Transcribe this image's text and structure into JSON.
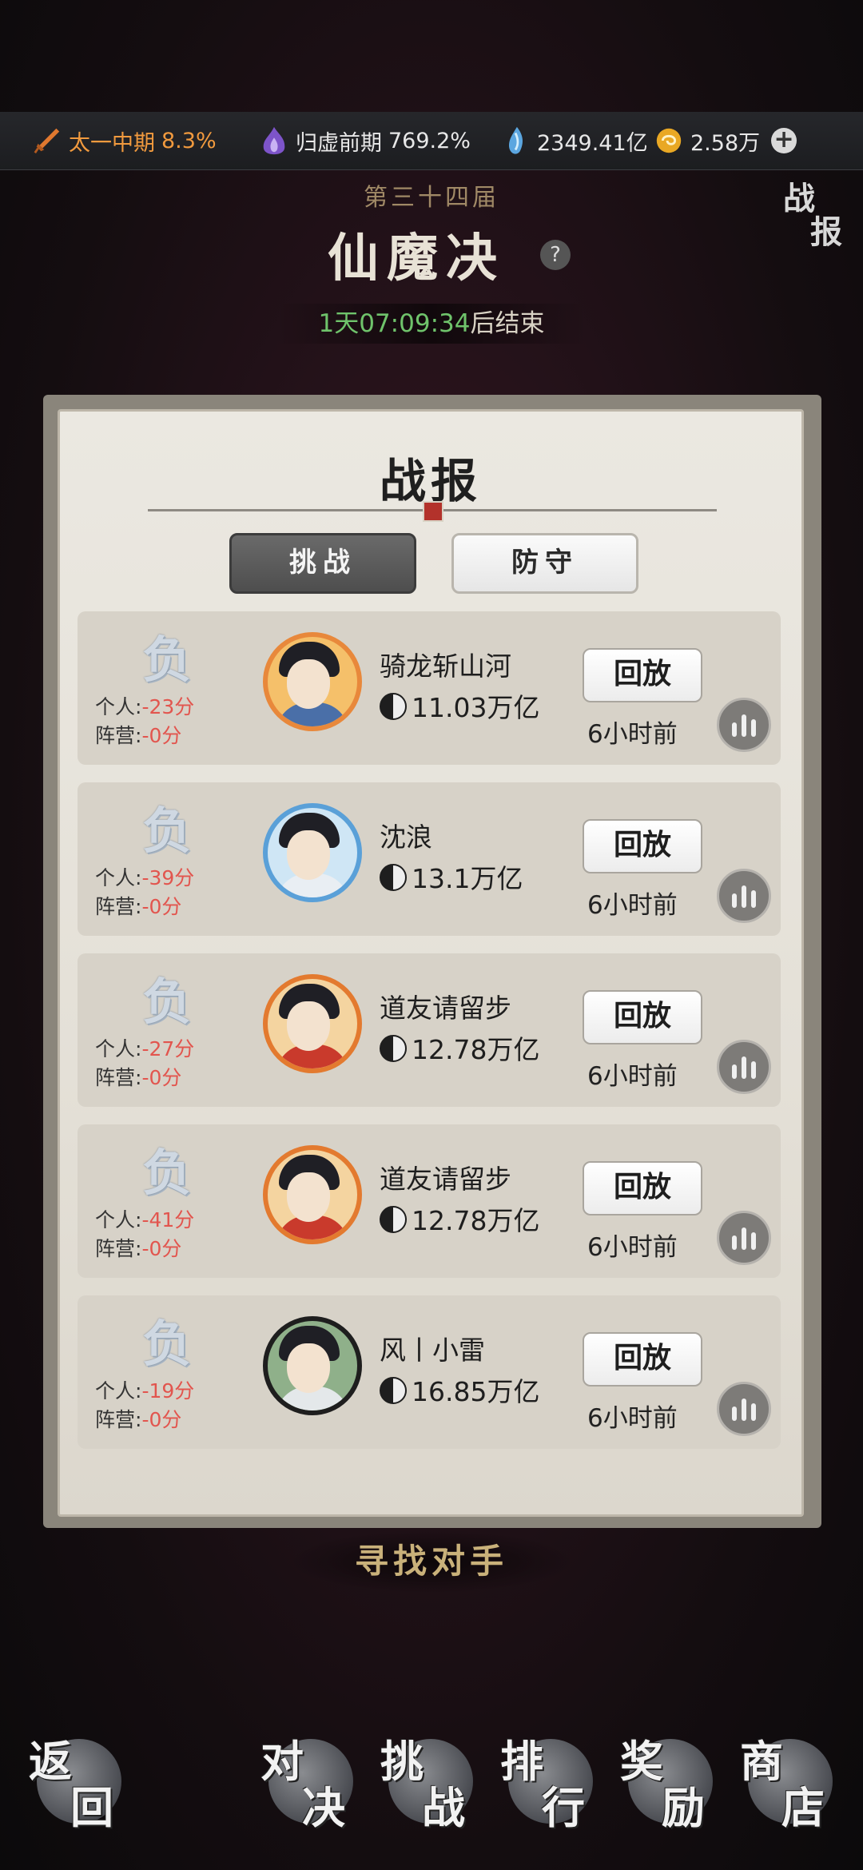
{
  "topbar": {
    "realm": "太一中期",
    "realm_pct": "8.3%",
    "realm2": "归虚前期",
    "realm2_pct": "769.2%",
    "crystals": "2349.41亿",
    "coins": "2.58万",
    "colors": {
      "orange": "#f19a3e",
      "white": "#e8e8e8"
    }
  },
  "header": {
    "season": "第三十四届",
    "title": "仙魔决",
    "timer_value": "1天07:09:34",
    "timer_suffix": "后结束",
    "report_corner": [
      "战",
      "报"
    ]
  },
  "panel": {
    "title": "战报",
    "tabs": [
      "挑战",
      "防守"
    ]
  },
  "records": [
    {
      "result": "负",
      "personal_label": "个人:",
      "personal": "-23分",
      "camp_label": "阵营:",
      "camp": "-0分",
      "name": "骑龙斩山河",
      "power": "11.03万亿",
      "replay": "回放",
      "time": "6小时前"
    },
    {
      "result": "负",
      "personal_label": "个人:",
      "personal": "-39分",
      "camp_label": "阵营:",
      "camp": "-0分",
      "name": "沈浪",
      "power": "13.1万亿",
      "replay": "回放",
      "time": "6小时前"
    },
    {
      "result": "负",
      "personal_label": "个人:",
      "personal": "-27分",
      "camp_label": "阵营:",
      "camp": "-0分",
      "name": "道友请留步",
      "power": "12.78万亿",
      "replay": "回放",
      "time": "6小时前"
    },
    {
      "result": "负",
      "personal_label": "个人:",
      "personal": "-41分",
      "camp_label": "阵营:",
      "camp": "-0分",
      "name": "道友请留步",
      "power": "12.78万亿",
      "replay": "回放",
      "time": "6小时前"
    },
    {
      "result": "负",
      "personal_label": "个人:",
      "personal": "-19分",
      "camp_label": "阵营:",
      "camp": "-0分",
      "name": "风丨小雷",
      "power": "16.85万亿",
      "replay": "回放",
      "time": "6小时前"
    }
  ],
  "find_opponent": "寻找对手",
  "bottom_nav": [
    {
      "a": "返",
      "b": "回"
    },
    {
      "a": "对",
      "b": "决"
    },
    {
      "a": "挑",
      "b": "战"
    },
    {
      "a": "排",
      "b": "行"
    },
    {
      "a": "奖",
      "b": "励"
    },
    {
      "a": "商",
      "b": "店"
    }
  ]
}
